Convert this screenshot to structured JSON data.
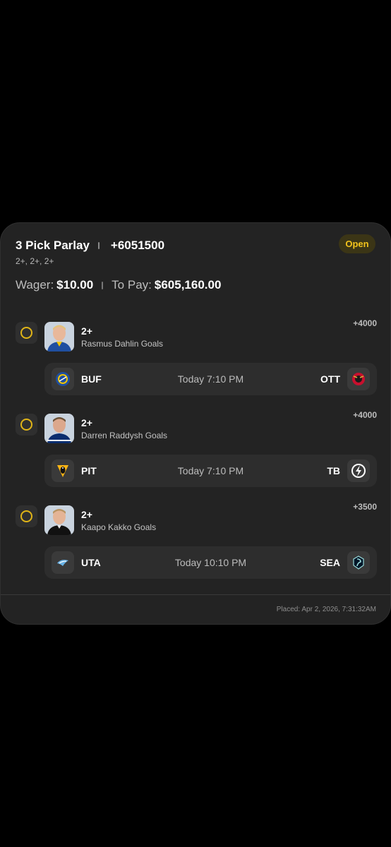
{
  "parlay": {
    "title": "3 Pick Parlay",
    "odds": "+6051500",
    "subtitle": "2+, 2+, 2+",
    "status": "Open",
    "wager_label": "Wager:",
    "wager_value": "$10.00",
    "pay_label": "To Pay:",
    "pay_value": "$605,160.00",
    "placed": "Placed: Apr 2, 2026, 7:31:32AM"
  },
  "legs": [
    {
      "line": "2+",
      "market": "Rasmus Dahlin Goals",
      "odds": "+4000",
      "home_team": "BUF",
      "away_team": "OTT",
      "time": "Today 7:10 PM",
      "home_logo": "sabres-logo-icon",
      "away_logo": "senators-logo-icon"
    },
    {
      "line": "2+",
      "market": "Darren Raddysh Goals",
      "odds": "+4000",
      "home_team": "PIT",
      "away_team": "TB",
      "time": "Today 7:10 PM",
      "home_logo": "penguins-logo-icon",
      "away_logo": "lightning-logo-icon"
    },
    {
      "line": "2+",
      "market": "Kaapo Kakko Goals",
      "odds": "+3500",
      "home_team": "UTA",
      "away_team": "SEA",
      "time": "Today 10:10 PM",
      "home_logo": "utah-logo-icon",
      "away_logo": "kraken-logo-icon"
    }
  ],
  "colors": {
    "accent": "#f2c31c",
    "card": "#232323",
    "badge_bg": "#3b3516"
  }
}
